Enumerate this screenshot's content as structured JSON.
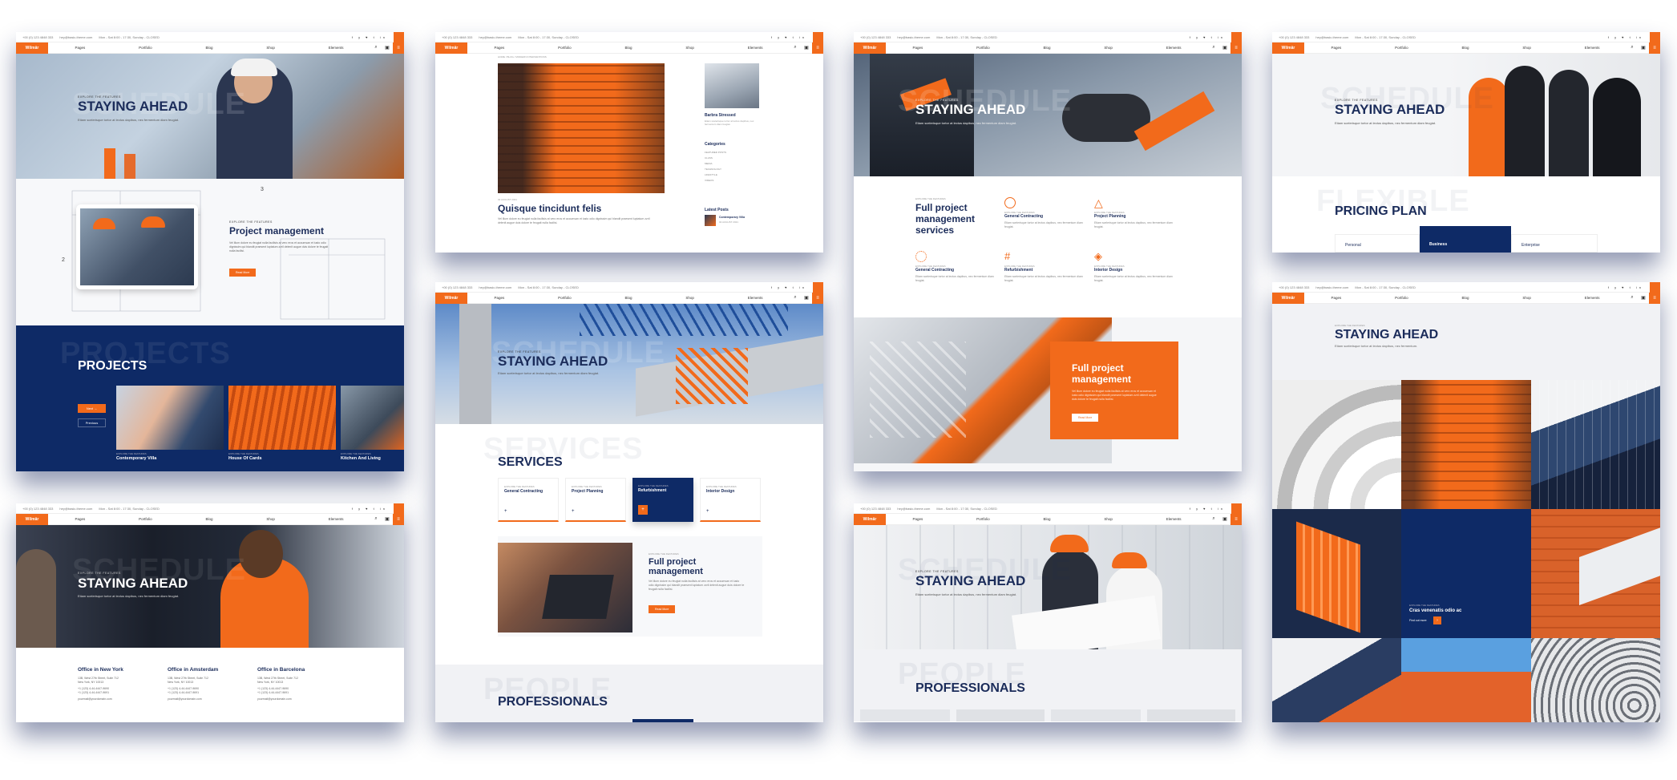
{
  "topbar": {
    "phone": "+00 (0) 123 4848 333",
    "email": "hey@basic-theme.com",
    "hours": "Mon - Sat 8:00 - 17:30, Sunday - CLOSED",
    "social": [
      "f",
      "y",
      "♥",
      "t",
      "in"
    ]
  },
  "nav": {
    "logo": "Wilmär",
    "items": [
      "Pages",
      "Portfolio",
      "Blog",
      "Shop",
      "Elements"
    ]
  },
  "kicker": "EXPLORE THE FEATURES",
  "hero_title": "STAYING AHEAD",
  "hero_sub": "Etiam scelerisque tortor at lectus dapibus, nec fermentum diam feugiat.",
  "lorem": "Vel illum dolore eu feugiat nulla facilisis at vero eros et accumsan et iusto odio dignissim qui blandit praesent luptatum zzril delenit augue duis dolore te feugait nulla facilisi.",
  "card1": {
    "pm_title": "Project management",
    "read_more": "Read More",
    "projects_title": "PROJECTS",
    "ghost_projects": "PROJECTS",
    "next": "Next",
    "previous": "Previous",
    "projects": [
      "Contemporary Villa",
      "House Of Cards",
      "Kitchen And Living"
    ],
    "drawing_numbers": [
      "1",
      "2",
      "3"
    ]
  },
  "card2": {
    "breadcrumb": "HOME / BLOG / MODERN INTERVENTIONS",
    "author": "Barbra Stressed",
    "categories_title": "Categories",
    "categories": [
      "FEATURED POSTS",
      "CLASS",
      "MEDIA",
      "TECHNOLOGY",
      "LIFESTYLE",
      "VIDEOS"
    ],
    "post_meta": "02 AUGUST 2021",
    "post_title": "Quisque tincidunt felis",
    "latest_posts": "Latest Posts",
    "latest_item": "Contemporary Villa",
    "latest_date": "02 AUGUST 2021"
  },
  "card3": {
    "ghost": "SCHEDULE",
    "services_heading": "Full project management services",
    "services": [
      "General Contracting",
      "Project Planning",
      "General Contracting",
      "Refurbishment",
      "Interior Design"
    ],
    "box_title": "Full project management",
    "read_more": "Read More"
  },
  "card4": {
    "ghost": "FLEXIBLE",
    "pricing_title": "PRICING PLAN",
    "plans": [
      "Personal",
      "Business",
      "Enterprise"
    ]
  },
  "card5": {
    "ghost": "SCHEDULE",
    "offices": [
      {
        "name": "Office in New York",
        "lines": [
          "13B, West 27th Street, Suite 712",
          "New York, NY 10013",
          "+1 (123) 4-44-4447-9690",
          "+1 (123) 4-44-4447-9691",
          "yourmail@yourdomain.com"
        ]
      },
      {
        "name": "Office in Amsterdam",
        "lines": [
          "13B, West 27th Street, Suite 712",
          "New York, NY 10013",
          "+1 (123) 4-44-4447-9690",
          "+1 (123) 4-44-4447-9691",
          "yourmail@yourdomain.com"
        ]
      },
      {
        "name": "Office in Barcelona",
        "lines": [
          "13B, West 27th Street, Suite 712",
          "New York, NY 10013",
          "+1 (123) 4-44-4447-9690",
          "+1 (123) 4-44-4447-9691",
          "yourmail@yourdomain.com"
        ]
      }
    ]
  },
  "card6": {
    "ghost": "SCHEDULE",
    "ghost_services": "SERVICES",
    "services_title": "SERVICES",
    "services": [
      "General Contracting",
      "Project Planning",
      "Refurbishment",
      "Interior Design"
    ],
    "pm_title": "Full project management",
    "read_more": "Read More",
    "ghost_people": "PEOPLE",
    "professionals": "PROFESSIONALS"
  },
  "card7": {
    "ghost": "SCHEDULE",
    "ghost_people": "PEOPLE",
    "professionals": "PROFESSIONALS"
  },
  "card8": {
    "subtitle": "Etiam scelerisque tortor at lectus dapibus, nec fermentum.",
    "tile_title": "Cras venenatis odio ac",
    "find_out_more": "Find out more"
  },
  "colors": {
    "orange": "#f26a1b",
    "navy": "#0e2a66",
    "dark": "#1b2c5a"
  }
}
